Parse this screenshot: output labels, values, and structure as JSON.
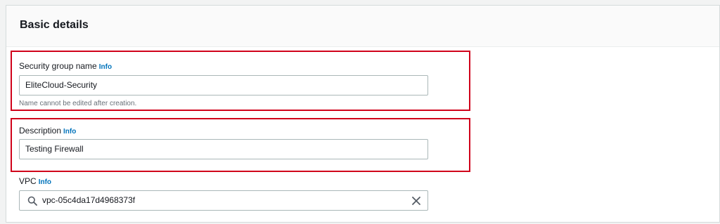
{
  "panel": {
    "title": "Basic details"
  },
  "fields": {
    "security_group_name": {
      "label": "Security group name",
      "info": "Info",
      "value": "EliteCloud-Security",
      "hint": "Name cannot be edited after creation."
    },
    "description": {
      "label": "Description",
      "info": "Info",
      "value": "Testing Firewall"
    },
    "vpc": {
      "label": "VPC",
      "info": "Info",
      "value": "vpc-05c4da17d4968373f",
      "search_icon": "search-icon",
      "clear_icon": "close-icon"
    }
  },
  "colors": {
    "highlight": "#d0021b",
    "info_link": "#0073bb"
  }
}
